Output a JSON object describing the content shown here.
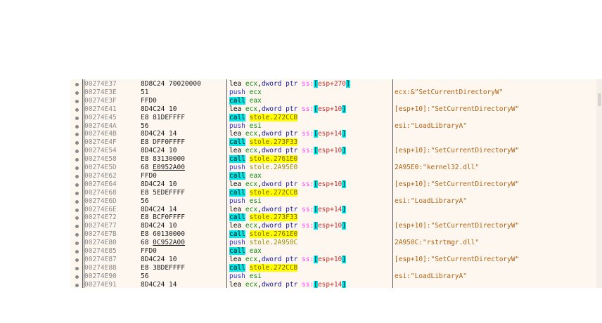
{
  "colors": {
    "background": "#fdf7f0",
    "call_highlight": "#00e8e8",
    "label_highlight": "#ffff00",
    "comment": "#b06010"
  },
  "rows": [
    {
      "address": "00274E37",
      "bytes": "8D8C24 70020000",
      "disasm": [
        {
          "t": "lea",
          "k": "mnemonic"
        },
        {
          "t": " ",
          "k": "plain"
        },
        {
          "t": "ecx",
          "k": "register"
        },
        {
          "t": ",",
          "k": "plain"
        },
        {
          "t": "dword ptr",
          "k": "keyword"
        },
        {
          "t": " ",
          "k": "plain"
        },
        {
          "t": "ss:",
          "k": "segment"
        },
        {
          "t": "[",
          "k": "bracket"
        },
        {
          "t": "esp+270",
          "k": "offset"
        },
        {
          "t": "]",
          "k": "bracket"
        }
      ],
      "comment": ""
    },
    {
      "address": "00274E3E",
      "bytes": "51",
      "disasm": [
        {
          "t": "push",
          "k": "push"
        },
        {
          "t": " ",
          "k": "plain"
        },
        {
          "t": "ecx",
          "k": "register"
        }
      ],
      "comment": "ecx:&\"SetCurrentDirectoryW\""
    },
    {
      "address": "00274E3F",
      "bytes": "FFD0",
      "disasm": [
        {
          "t": "call",
          "k": "call"
        },
        {
          "t": " ",
          "k": "plain"
        },
        {
          "t": "eax",
          "k": "register"
        }
      ],
      "comment": ""
    },
    {
      "address": "00274E41",
      "bytes": "8D4C24 10",
      "disasm": [
        {
          "t": "lea",
          "k": "mnemonic"
        },
        {
          "t": " ",
          "k": "plain"
        },
        {
          "t": "ecx",
          "k": "register"
        },
        {
          "t": ",",
          "k": "plain"
        },
        {
          "t": "dword ptr",
          "k": "keyword"
        },
        {
          "t": " ",
          "k": "plain"
        },
        {
          "t": "ss:",
          "k": "segment"
        },
        {
          "t": "[",
          "k": "bracket"
        },
        {
          "t": "esp+10",
          "k": "offset"
        },
        {
          "t": "]",
          "k": "bracket"
        }
      ],
      "comment": "[esp+10]:\"SetCurrentDirectoryW\""
    },
    {
      "address": "00274E45",
      "bytes": "E8 81DEFFFF",
      "disasm": [
        {
          "t": "call",
          "k": "call"
        },
        {
          "t": " ",
          "k": "plain"
        },
        {
          "t": "stole.272CCB",
          "k": "label"
        }
      ],
      "comment": ""
    },
    {
      "address": "00274E4A",
      "bytes": "56",
      "disasm": [
        {
          "t": "push",
          "k": "push"
        },
        {
          "t": " ",
          "k": "plain"
        },
        {
          "t": "esi",
          "k": "register"
        }
      ],
      "comment": "esi:\"LoadLibraryA\""
    },
    {
      "address": "00274E4B",
      "bytes": "8D4C24 14",
      "disasm": [
        {
          "t": "lea",
          "k": "mnemonic"
        },
        {
          "t": " ",
          "k": "plain"
        },
        {
          "t": "ecx",
          "k": "register"
        },
        {
          "t": ",",
          "k": "plain"
        },
        {
          "t": "dword ptr",
          "k": "keyword"
        },
        {
          "t": " ",
          "k": "plain"
        },
        {
          "t": "ss:",
          "k": "segment"
        },
        {
          "t": "[",
          "k": "bracket"
        },
        {
          "t": "esp+14",
          "k": "offset"
        },
        {
          "t": "]",
          "k": "bracket"
        }
      ],
      "comment": ""
    },
    {
      "address": "00274E4F",
      "bytes": "E8 DFF0FFFF",
      "disasm": [
        {
          "t": "call",
          "k": "call"
        },
        {
          "t": " ",
          "k": "plain"
        },
        {
          "t": "stole.273F33",
          "k": "label"
        }
      ],
      "comment": ""
    },
    {
      "address": "00274E54",
      "bytes": "8D4C24 10",
      "disasm": [
        {
          "t": "lea",
          "k": "mnemonic"
        },
        {
          "t": " ",
          "k": "plain"
        },
        {
          "t": "ecx",
          "k": "register"
        },
        {
          "t": ",",
          "k": "plain"
        },
        {
          "t": "dword ptr",
          "k": "keyword"
        },
        {
          "t": " ",
          "k": "plain"
        },
        {
          "t": "ss:",
          "k": "segment"
        },
        {
          "t": "[",
          "k": "bracket"
        },
        {
          "t": "esp+10",
          "k": "offset"
        },
        {
          "t": "]",
          "k": "bracket"
        }
      ],
      "comment": "[esp+10]:\"SetCurrentDirectoryW\""
    },
    {
      "address": "00274E58",
      "bytes": "E8 83130000",
      "disasm": [
        {
          "t": "call",
          "k": "call"
        },
        {
          "t": " ",
          "k": "plain"
        },
        {
          "t": "stole.2761E0",
          "k": "label"
        }
      ],
      "comment": ""
    },
    {
      "address": "00274E5D",
      "bytes": "68 ",
      "bytes_ref": "E0952A00",
      "disasm": [
        {
          "t": "push",
          "k": "push"
        },
        {
          "t": " ",
          "k": "plain"
        },
        {
          "t": "stole.2A95E0",
          "k": "address"
        }
      ],
      "comment": "2A95E0:\"kernel32.dll\""
    },
    {
      "address": "00274E62",
      "bytes": "FFD0",
      "disasm": [
        {
          "t": "call",
          "k": "call"
        },
        {
          "t": " ",
          "k": "plain"
        },
        {
          "t": "eax",
          "k": "register"
        }
      ],
      "comment": ""
    },
    {
      "address": "00274E64",
      "bytes": "8D4C24 10",
      "disasm": [
        {
          "t": "lea",
          "k": "mnemonic"
        },
        {
          "t": " ",
          "k": "plain"
        },
        {
          "t": "ecx",
          "k": "register"
        },
        {
          "t": ",",
          "k": "plain"
        },
        {
          "t": "dword ptr",
          "k": "keyword"
        },
        {
          "t": " ",
          "k": "plain"
        },
        {
          "t": "ss:",
          "k": "segment"
        },
        {
          "t": "[",
          "k": "bracket"
        },
        {
          "t": "esp+10",
          "k": "offset"
        },
        {
          "t": "]",
          "k": "bracket"
        }
      ],
      "comment": "[esp+10]:\"SetCurrentDirectoryW\""
    },
    {
      "address": "00274E68",
      "bytes": "E8 5EDEFFFF",
      "disasm": [
        {
          "t": "call",
          "k": "call"
        },
        {
          "t": " ",
          "k": "plain"
        },
        {
          "t": "stole.272CCB",
          "k": "label"
        }
      ],
      "comment": ""
    },
    {
      "address": "00274E6D",
      "bytes": "56",
      "disasm": [
        {
          "t": "push",
          "k": "push"
        },
        {
          "t": " ",
          "k": "plain"
        },
        {
          "t": "esi",
          "k": "register"
        }
      ],
      "comment": "esi:\"LoadLibraryA\""
    },
    {
      "address": "00274E6E",
      "bytes": "8D4C24 14",
      "disasm": [
        {
          "t": "lea",
          "k": "mnemonic"
        },
        {
          "t": " ",
          "k": "plain"
        },
        {
          "t": "ecx",
          "k": "register"
        },
        {
          "t": ",",
          "k": "plain"
        },
        {
          "t": "dword ptr",
          "k": "keyword"
        },
        {
          "t": " ",
          "k": "plain"
        },
        {
          "t": "ss:",
          "k": "segment"
        },
        {
          "t": "[",
          "k": "bracket"
        },
        {
          "t": "esp+14",
          "k": "offset"
        },
        {
          "t": "]",
          "k": "bracket"
        }
      ],
      "comment": ""
    },
    {
      "address": "00274E72",
      "bytes": "E8 BCF0FFFF",
      "disasm": [
        {
          "t": "call",
          "k": "call"
        },
        {
          "t": " ",
          "k": "plain"
        },
        {
          "t": "stole.273F33",
          "k": "label"
        }
      ],
      "comment": ""
    },
    {
      "address": "00274E77",
      "bytes": "8D4C24 10",
      "disasm": [
        {
          "t": "lea",
          "k": "mnemonic"
        },
        {
          "t": " ",
          "k": "plain"
        },
        {
          "t": "ecx",
          "k": "register"
        },
        {
          "t": ",",
          "k": "plain"
        },
        {
          "t": "dword ptr",
          "k": "keyword"
        },
        {
          "t": " ",
          "k": "plain"
        },
        {
          "t": "ss:",
          "k": "segment"
        },
        {
          "t": "[",
          "k": "bracket"
        },
        {
          "t": "esp+10",
          "k": "offset"
        },
        {
          "t": "]",
          "k": "bracket"
        }
      ],
      "comment": "[esp+10]:\"SetCurrentDirectoryW\""
    },
    {
      "address": "00274E7B",
      "bytes": "E8 60130000",
      "disasm": [
        {
          "t": "call",
          "k": "call"
        },
        {
          "t": " ",
          "k": "plain"
        },
        {
          "t": "stole.2761E0",
          "k": "label"
        }
      ],
      "comment": ""
    },
    {
      "address": "00274E80",
      "bytes": "68 ",
      "bytes_ref": "0C952A00",
      "disasm": [
        {
          "t": "push",
          "k": "push"
        },
        {
          "t": " ",
          "k": "plain"
        },
        {
          "t": "stole.2A950C",
          "k": "address"
        }
      ],
      "comment": "2A950C:\"rstrtmgr.dll\""
    },
    {
      "address": "00274E85",
      "bytes": "FFD0",
      "disasm": [
        {
          "t": "call",
          "k": "call"
        },
        {
          "t": " ",
          "k": "plain"
        },
        {
          "t": "eax",
          "k": "register"
        }
      ],
      "comment": ""
    },
    {
      "address": "00274E87",
      "bytes": "8D4C24 10",
      "disasm": [
        {
          "t": "lea",
          "k": "mnemonic"
        },
        {
          "t": " ",
          "k": "plain"
        },
        {
          "t": "ecx",
          "k": "register"
        },
        {
          "t": ",",
          "k": "plain"
        },
        {
          "t": "dword ptr",
          "k": "keyword"
        },
        {
          "t": " ",
          "k": "plain"
        },
        {
          "t": "ss:",
          "k": "segment"
        },
        {
          "t": "[",
          "k": "bracket"
        },
        {
          "t": "esp+10",
          "k": "offset"
        },
        {
          "t": "]",
          "k": "bracket"
        }
      ],
      "comment": "[esp+10]:\"SetCurrentDirectoryW\""
    },
    {
      "address": "00274E8B",
      "bytes": "E8 3BDEFFFF",
      "disasm": [
        {
          "t": "call",
          "k": "call"
        },
        {
          "t": " ",
          "k": "plain"
        },
        {
          "t": "stole.272CCB",
          "k": "label"
        }
      ],
      "comment": ""
    },
    {
      "address": "00274E90",
      "bytes": "56",
      "disasm": [
        {
          "t": "push",
          "k": "push"
        },
        {
          "t": " ",
          "k": "plain"
        },
        {
          "t": "esi",
          "k": "register"
        }
      ],
      "comment": "esi:\"LoadLibraryA\""
    },
    {
      "address": "00274E91",
      "bytes": "8D4C24 14",
      "disasm": [
        {
          "t": "lea",
          "k": "mnemonic"
        },
        {
          "t": " ",
          "k": "plain"
        },
        {
          "t": "ecx",
          "k": "register"
        },
        {
          "t": ",",
          "k": "plain"
        },
        {
          "t": "dword ptr",
          "k": "keyword"
        },
        {
          "t": " ",
          "k": "plain"
        },
        {
          "t": "ss:",
          "k": "segment"
        },
        {
          "t": "[",
          "k": "bracket"
        },
        {
          "t": "esp+14",
          "k": "offset"
        },
        {
          "t": "]",
          "k": "bracket"
        }
      ],
      "comment": ""
    }
  ]
}
